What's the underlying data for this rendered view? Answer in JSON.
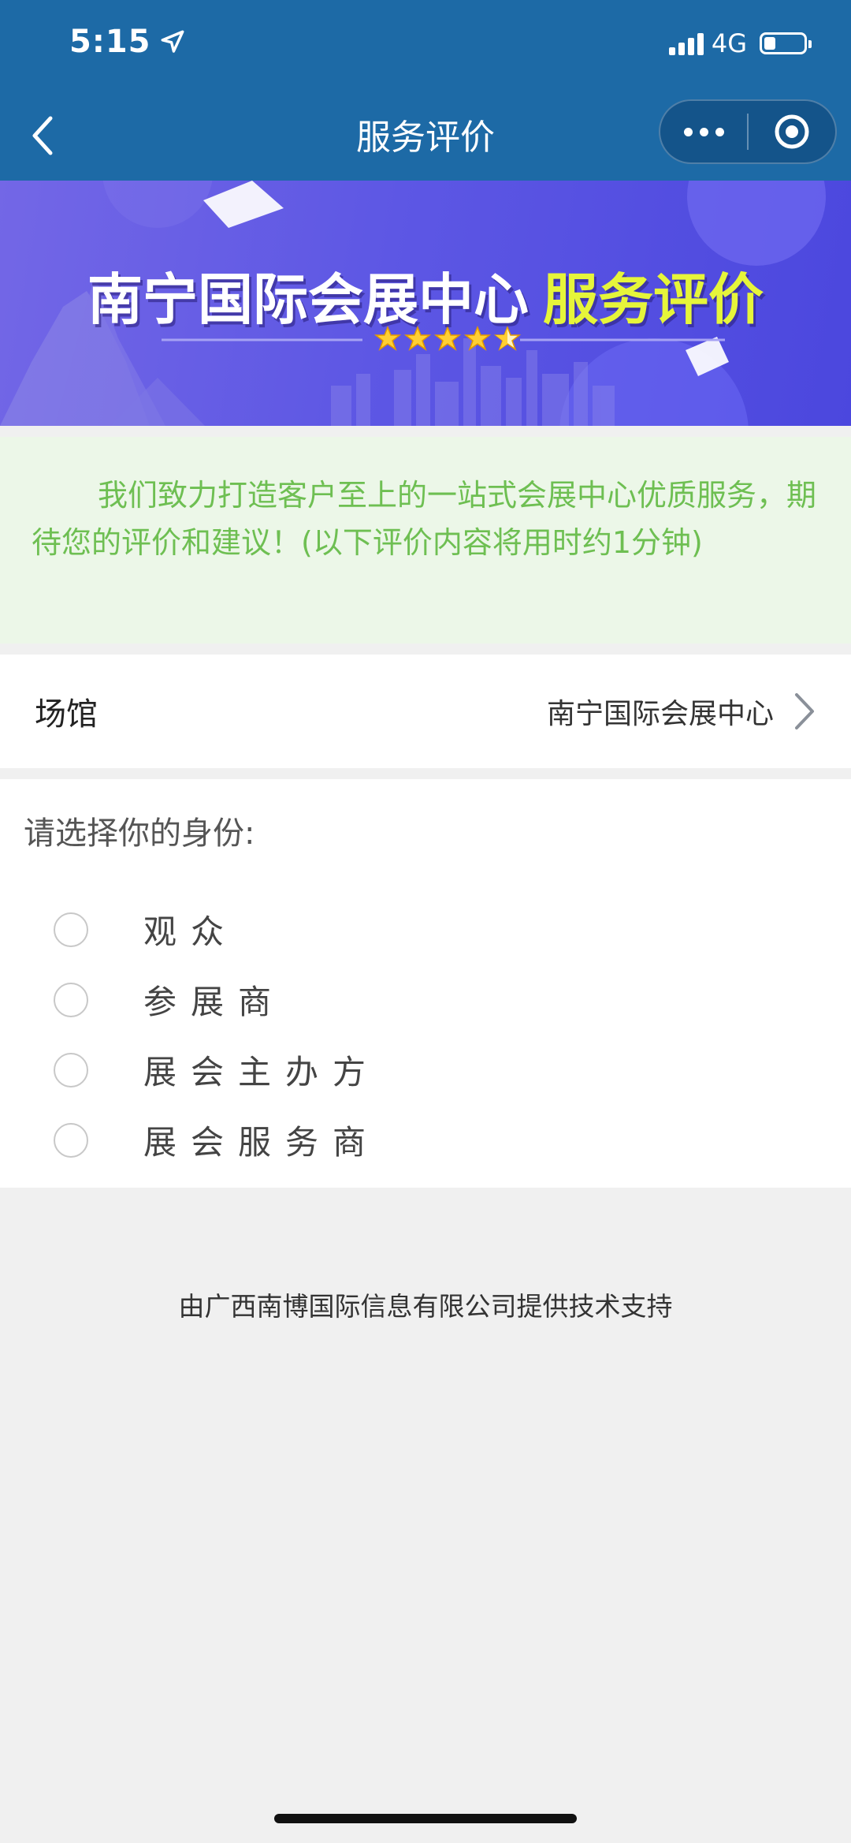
{
  "status_bar": {
    "time": "5:15",
    "network": "4G"
  },
  "nav": {
    "title": "服务评价"
  },
  "banner": {
    "title_main": "南宁国际会展中心",
    "title_highlight": "服务评价",
    "stars": 4.5
  },
  "notice": {
    "text": "我们致力打造客户至上的一站式会展中心优质服务，期待您的评价和建议！(以下评价内容将用时约1分钟)"
  },
  "venue": {
    "label": "场馆",
    "value": "南宁国际会展中心"
  },
  "identity": {
    "question": "请选择你的身份:",
    "options": [
      {
        "label": "观众"
      },
      {
        "label": "参展商"
      },
      {
        "label": "展会主办方"
      },
      {
        "label": "展会服务商"
      }
    ]
  },
  "footer": {
    "text": "由广西南博国际信息有限公司提供技术支持"
  },
  "colors": {
    "header": "#1d6aa6",
    "notice_bg": "#ecf7e8",
    "notice_text": "#6ebf52",
    "banner_highlight": "#e6f53a"
  }
}
